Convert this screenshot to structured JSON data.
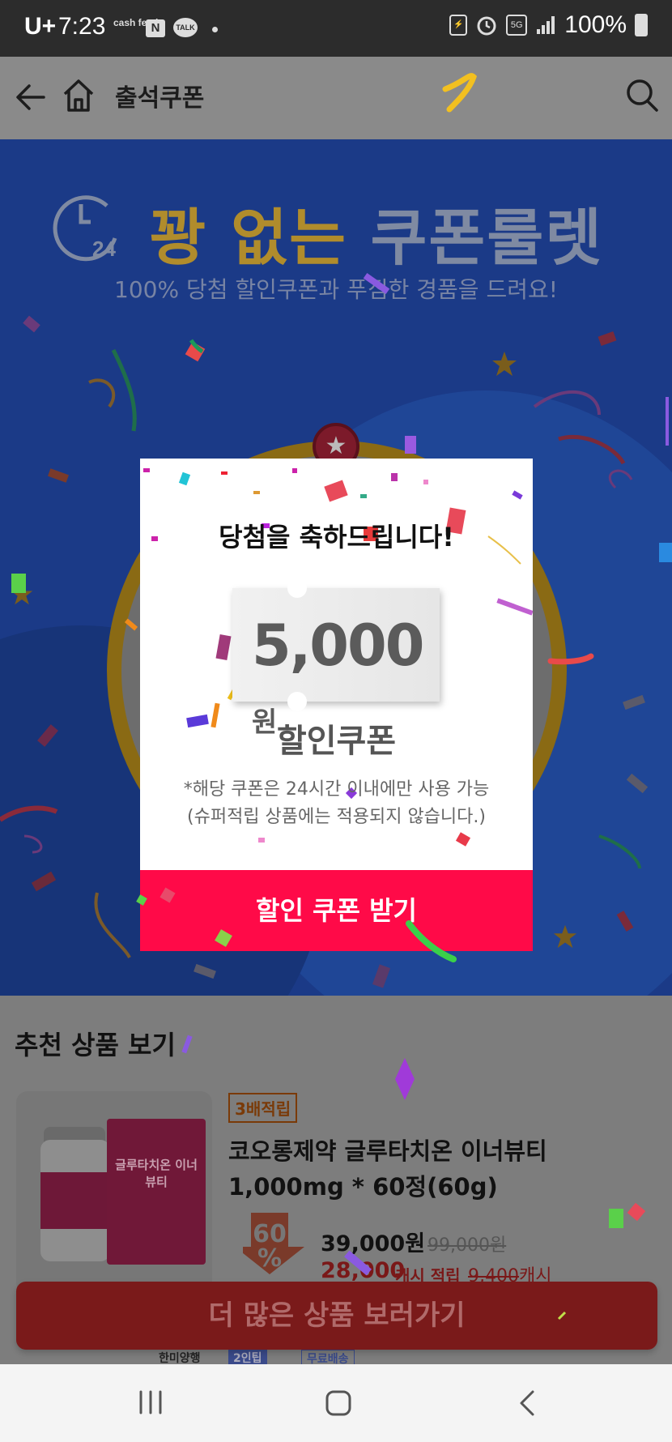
{
  "status_bar": {
    "carrier": "U+",
    "time": "7:23",
    "cashfeed": "cash feed",
    "naver": "N",
    "talk": "TALK",
    "network": "5G",
    "battery": "100%"
  },
  "app_bar": {
    "title": "출석쿠폰"
  },
  "hero": {
    "clock_number": "24",
    "title_gold": "꽝 없는",
    "title_gray": "쿠폰룰렛",
    "subtitle": "100% 당첨 할인쿠폰과 푸짐한 경품을 드려요!"
  },
  "popup": {
    "title": "당첨을 축하드립니다!",
    "amount": "5,000",
    "unit": "원",
    "coupon_label": "할인쿠폰",
    "notice_line1": "*해당 쿠폰은 24시간 이내에만 사용 가능",
    "notice_line2": "(슈퍼적립 상품에는 적용되지 않습니다.)",
    "claim_button": "할인 쿠폰 받기"
  },
  "recommend": {
    "title": "추천 상품 보기",
    "product": {
      "box_label": "글루타치온 이너뷰티",
      "badge": "3배적립",
      "name_line1": "코오롱제약 글루타치온 이너뷰티",
      "name_line2": "1,000mg * 60정(60g)",
      "discount": "60",
      "discount_unit": "%",
      "price": "39,000원",
      "original_price": "99,000원",
      "cash_price": "28,000",
      "cash_label": "캐시 적립",
      "cash_original": "9,400",
      "cash_original_unit": "캐시"
    },
    "more_button": "더 많은 상품 보러가기",
    "next_item_tags": [
      "한미양행",
      "2인팁",
      "무료배송"
    ]
  },
  "colors": {
    "popup_button": "#ff0a48",
    "hero_blue_dimmed": "#1b3a87",
    "gold_dimmed": "#b08c2c"
  }
}
